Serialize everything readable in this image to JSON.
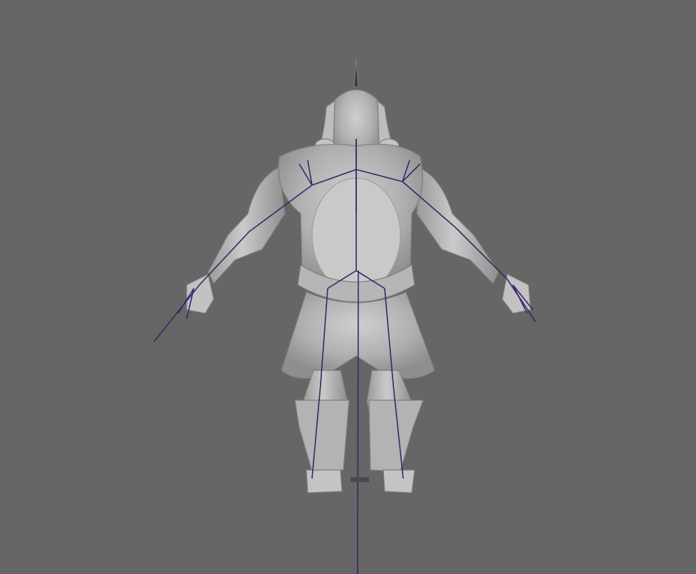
{
  "viewport": {
    "background_color": "#666666",
    "mesh_color": "#b4b4b4",
    "mesh_shadow_color": "#8c8c8c",
    "mesh_highlight_color": "#d6d6d6",
    "joint_color": "#3c2466"
  }
}
